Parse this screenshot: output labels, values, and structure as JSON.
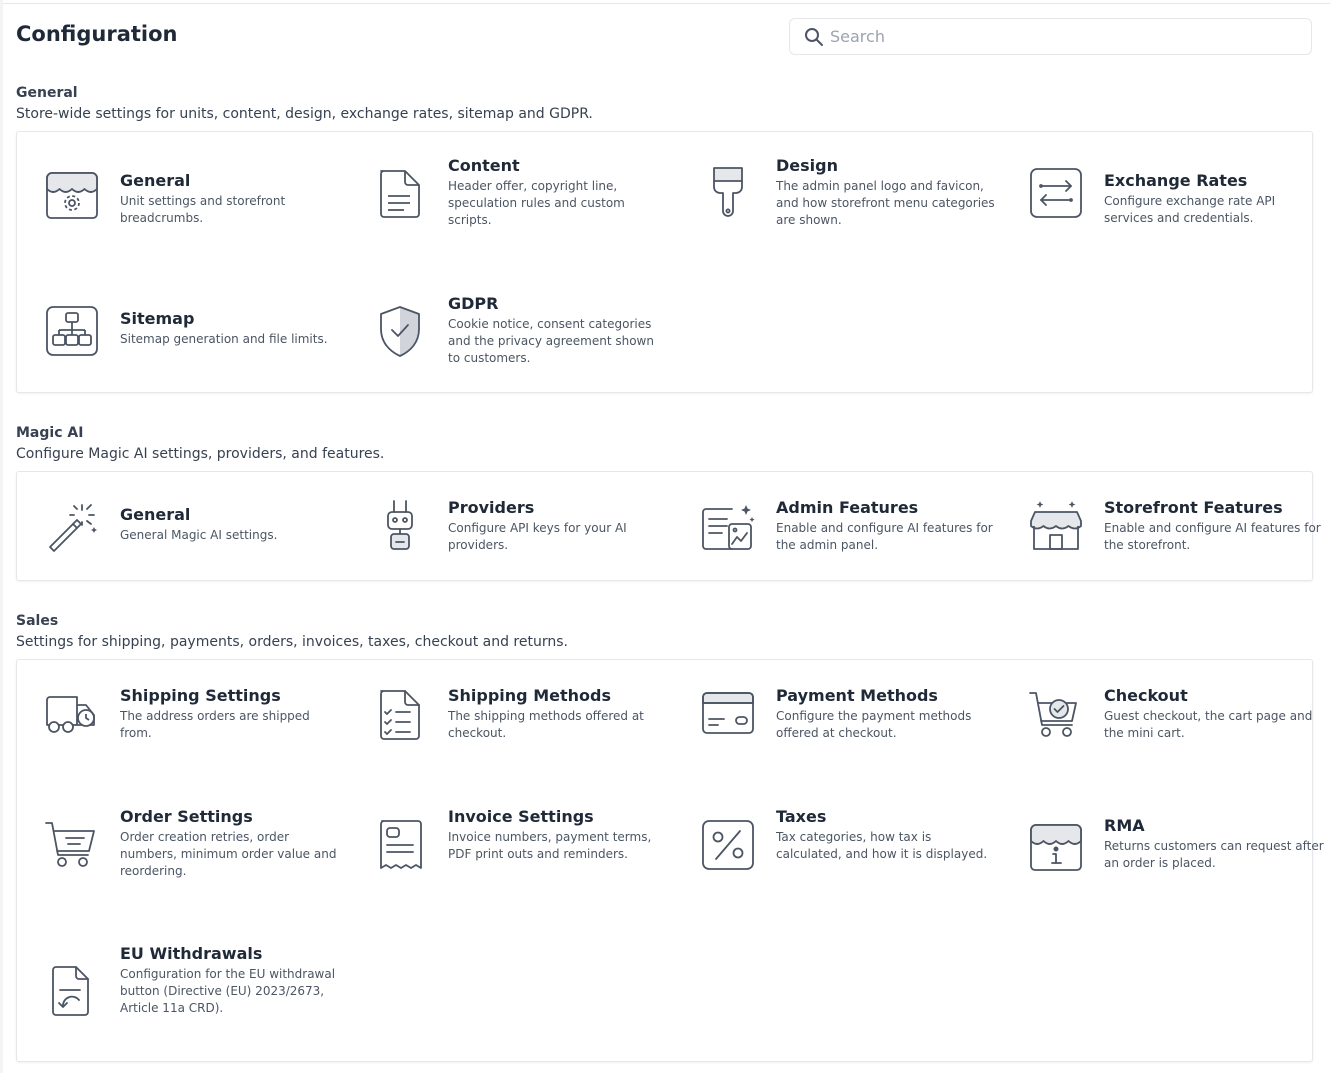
{
  "header": {
    "title": "Configuration",
    "search_placeholder": "Search"
  },
  "sections": [
    {
      "title": "General",
      "description": "Store-wide settings for units, content, design, exchange rates, sitemap and GDPR.",
      "items": [
        {
          "title": "General",
          "description": "Unit settings and storefront breadcrumbs.",
          "icon": "store-settings-icon"
        },
        {
          "title": "Content",
          "description": "Header offer, copyright line, speculation rules and custom scripts.",
          "icon": "document-icon"
        },
        {
          "title": "Design",
          "description": "The admin panel logo and favicon, and how storefront menu categories are shown.",
          "icon": "paintbrush-icon"
        },
        {
          "title": "Exchange Rates",
          "description": "Configure exchange rate API services and credentials.",
          "icon": "exchange-arrows-icon"
        },
        {
          "title": "Sitemap",
          "description": "Sitemap generation and file limits.",
          "icon": "sitemap-icon"
        },
        {
          "title": "GDPR",
          "description": "Cookie notice, consent categories and the privacy agreement shown to customers.",
          "icon": "shield-check-icon"
        }
      ]
    },
    {
      "title": "Magic AI",
      "description": "Configure Magic AI settings, providers, and features.",
      "items": [
        {
          "title": "General",
          "description": "General Magic AI settings.",
          "icon": "magic-wand-icon"
        },
        {
          "title": "Providers",
          "description": "Configure API keys for your AI providers.",
          "icon": "robot-plug-icon"
        },
        {
          "title": "Admin Features",
          "description": "Enable and configure AI features for the admin panel.",
          "icon": "ai-document-icon"
        },
        {
          "title": "Storefront Features",
          "description": "Enable and configure AI features for the storefront.",
          "icon": "ai-storefront-icon"
        }
      ]
    },
    {
      "title": "Sales",
      "description": "Settings for shipping, payments, orders, invoices, taxes, checkout and returns.",
      "items": [
        {
          "title": "Shipping Settings",
          "description": "The address orders are shipped from.",
          "icon": "delivery-truck-icon"
        },
        {
          "title": "Shipping Methods",
          "description": "The shipping methods offered at checkout.",
          "icon": "checklist-icon"
        },
        {
          "title": "Payment Methods",
          "description": "Configure the payment methods offered at checkout.",
          "icon": "credit-card-icon"
        },
        {
          "title": "Checkout",
          "description": "Guest checkout, the cart page and the mini cart.",
          "icon": "cart-check-icon"
        },
        {
          "title": "Order Settings",
          "description": "Order creation retries, order numbers, minimum order value and reordering.",
          "icon": "cart-list-icon"
        },
        {
          "title": "Invoice Settings",
          "description": "Invoice numbers, payment terms, PDF print outs and reminders.",
          "icon": "invoice-icon"
        },
        {
          "title": "Taxes",
          "description": "Tax categories, how tax is calculated, and how it is displayed.",
          "icon": "percent-icon"
        },
        {
          "title": "RMA",
          "description": "Returns customers can request after an order is placed.",
          "icon": "store-info-icon"
        },
        {
          "title": "EU Withdrawals",
          "description": "Configuration for the EU withdrawal button (Directive (EU) 2023/2673, Article 11a CRD).",
          "icon": "document-return-icon"
        }
      ]
    }
  ]
}
